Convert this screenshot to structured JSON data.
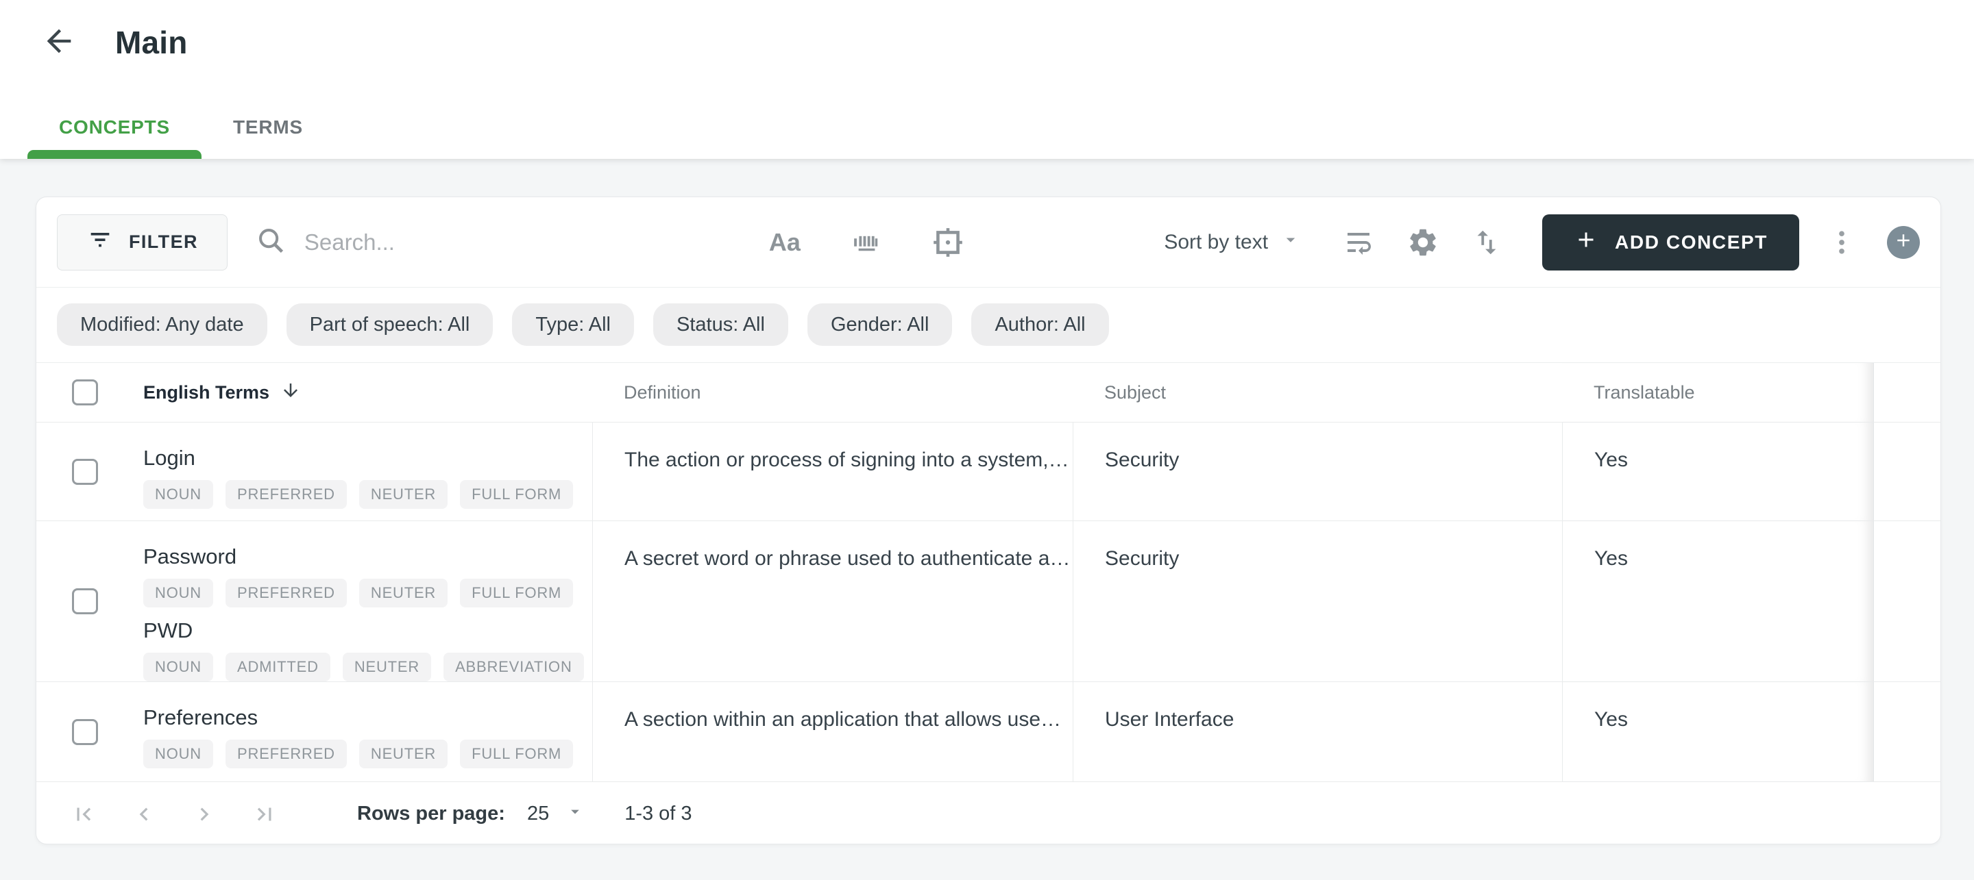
{
  "header": {
    "title": "Main"
  },
  "tabs": {
    "concepts": "CONCEPTS",
    "terms": "TERMS"
  },
  "toolbar": {
    "filter_label": "FILTER",
    "search_placeholder": "Search...",
    "match_case_label": "Aa",
    "sort_label": "Sort by text",
    "add_concept_label": "ADD CONCEPT"
  },
  "filter_chips": {
    "modified": "Modified: Any date",
    "part_of_speech": "Part of speech: All",
    "type": "Type: All",
    "status": "Status: All",
    "gender": "Gender: All",
    "author": "Author: All"
  },
  "table": {
    "columns": {
      "terms": "English Terms",
      "definition": "Definition",
      "subject": "Subject",
      "translatable": "Translatable"
    },
    "rows": [
      {
        "terms": [
          {
            "text": "Login",
            "tags": [
              "NOUN",
              "PREFERRED",
              "NEUTER",
              "FULL FORM"
            ]
          }
        ],
        "definition": "The action or process of signing into a system,…",
        "subject": "Security",
        "translatable": "Yes"
      },
      {
        "terms": [
          {
            "text": "Password",
            "tags": [
              "NOUN",
              "PREFERRED",
              "NEUTER",
              "FULL FORM"
            ]
          },
          {
            "text": "PWD",
            "tags": [
              "NOUN",
              "ADMITTED",
              "NEUTER",
              "ABBREVIATION"
            ]
          }
        ],
        "definition": "A secret word or phrase used to authenticate a…",
        "subject": "Security",
        "translatable": "Yes"
      },
      {
        "terms": [
          {
            "text": "Preferences",
            "tags": [
              "NOUN",
              "PREFERRED",
              "NEUTER",
              "FULL FORM"
            ]
          }
        ],
        "definition": "A section within an application that allows use…",
        "subject": "User Interface",
        "translatable": "Yes"
      }
    ]
  },
  "pagination": {
    "rows_per_page_label": "Rows per page:",
    "rows_per_page_value": "25",
    "range": "1-3 of 3"
  },
  "icons": {
    "back": "arrow-left",
    "filter": "filter-lines",
    "search": "magnifier",
    "match_case": "Aa",
    "term_bars": "barcode",
    "exact_match": "crosshair-frame",
    "sort_caret": "caret-down",
    "wrap": "wrap-text",
    "settings": "gear",
    "import_export": "arrows-up-down",
    "add": "plus",
    "more": "kebab-vertical",
    "quick_add": "plus-circle",
    "sort_direction": "arrow-down",
    "pager": [
      "first-page",
      "chevron-left",
      "chevron-right",
      "last-page"
    ]
  },
  "colors": {
    "accent_green": "#43a047",
    "dark_button": "#263238",
    "circle_button": "#7d8d97",
    "page_background": "#f4f6f7"
  }
}
